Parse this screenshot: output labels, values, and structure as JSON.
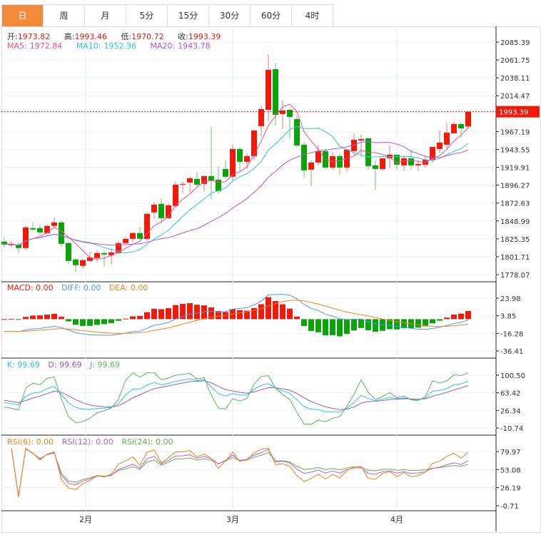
{
  "tabs": [
    {
      "label": "日",
      "active": true
    },
    {
      "label": "周"
    },
    {
      "label": "月"
    },
    {
      "label": "5分"
    },
    {
      "label": "15分"
    },
    {
      "label": "30分"
    },
    {
      "label": "60分"
    },
    {
      "label": "4时"
    }
  ],
  "ohlc_legend": {
    "open_label": "开:",
    "open": "1973.82",
    "high_label": "高:",
    "high": "1993.46",
    "low_label": "低:",
    "low": "1970.72",
    "close_label": "收:",
    "close": "1993.39"
  },
  "ma_legend": {
    "ma5_label": "MA5:",
    "ma5": "1972.84",
    "ma10_label": "MA10:",
    "ma10": "1952.36",
    "ma20_label": "MA20:",
    "ma20": "1943.78"
  },
  "macd_legend": {
    "macd": "MACD: 0.00",
    "diff": "DIFF: 0.00",
    "dea": "DEA: 0.00"
  },
  "kdj_legend": {
    "k": "K: 99.69",
    "d": "D: 99.69",
    "j": "J: 99.69"
  },
  "rsi_legend": {
    "rsi6": "RSI(6): 0.00",
    "rsi12": "RSI(12): 0.00",
    "rsi24": "RSI(24): 0.00"
  },
  "colors": {
    "up": "#f0190a",
    "down": "#0aa30a",
    "ma5": "#f0508c",
    "ma10": "#2ec7e0",
    "ma20": "#b25ad1",
    "diff": "#4a9ee8",
    "dea": "#f5821f",
    "k": "#2ec7e0",
    "d": "#8a5cd1",
    "j": "#5cb85c",
    "rsi6": "#f5821f",
    "rsi12": "#b362d0",
    "rsi24": "#62b34a",
    "accent": "#f28c3c"
  },
  "chart_data": {
    "type": "candlestick",
    "last_price_label": "1993.39",
    "last_price": 1993.39,
    "price_ticks": [
      "2085.39",
      "2061.75",
      "2038.11",
      "2014.47",
      "1967.19",
      "1943.55",
      "1919.91",
      "1896.27",
      "1872.63",
      "1848.99",
      "1825.35",
      "1801.71",
      "1778.07"
    ],
    "price_range": [
      1778.07,
      2085.39
    ],
    "macd_ticks": [
      "23.98",
      "3.85",
      "-16.28",
      "-36.41"
    ],
    "macd_range": [
      -36.41,
      23.98
    ],
    "kdj_ticks": [
      "100.50",
      "63.42",
      "26.34",
      "-10.74"
    ],
    "kdj_range": [
      -10.74,
      100.5
    ],
    "rsi_ticks": [
      "79.97",
      "53.08",
      "26.19",
      "-0.71"
    ],
    "rsi_range": [
      -0.71,
      79.97
    ],
    "x_labels": [
      {
        "label": "2月",
        "index": 12
      },
      {
        "label": "3月",
        "index": 32
      },
      {
        "label": "4月",
        "index": 55
      }
    ],
    "candles": [
      [
        1821.7,
        1827.3,
        1814.1,
        1817.9
      ],
      [
        1817.0,
        1822.6,
        1814.1,
        1818.8
      ],
      [
        1817.9,
        1820.7,
        1806.6,
        1813.2
      ],
      [
        1813.2,
        1843.3,
        1810.4,
        1840.5
      ],
      [
        1839.6,
        1847.1,
        1835.8,
        1837.7
      ],
      [
        1839.6,
        1843.3,
        1830.1,
        1833.9
      ],
      [
        1833.0,
        1844.3,
        1831.1,
        1842.4
      ],
      [
        1842.4,
        1853.7,
        1839.6,
        1847.1
      ],
      [
        1847.1,
        1849.9,
        1815.1,
        1818.8
      ],
      [
        1819.8,
        1821.7,
        1791.5,
        1796.2
      ],
      [
        1798.1,
        1800.0,
        1781.2,
        1790.6
      ],
      [
        1789.6,
        1799.1,
        1785.9,
        1797.2
      ],
      [
        1796.2,
        1808.5,
        1795.3,
        1800.9
      ],
      [
        1800.0,
        1810.4,
        1794.3,
        1806.6
      ],
      [
        1806.6,
        1809.4,
        1788.7,
        1804.7
      ],
      [
        1803.8,
        1813.2,
        1791.5,
        1807.5
      ],
      [
        1806.6,
        1822.6,
        1805.6,
        1819.8
      ],
      [
        1819.8,
        1827.3,
        1817.9,
        1825.4
      ],
      [
        1825.4,
        1834.8,
        1821.7,
        1833.0
      ],
      [
        1833.0,
        1841.4,
        1825.4,
        1825.4
      ],
      [
        1825.4,
        1861.2,
        1822.6,
        1858.4
      ],
      [
        1860.3,
        1873.5,
        1851.8,
        1870.6
      ],
      [
        1871.6,
        1879.1,
        1845.2,
        1852.7
      ],
      [
        1852.7,
        1872.5,
        1850.9,
        1869.7
      ],
      [
        1868.8,
        1900.8,
        1866.9,
        1897.0
      ],
      [
        1897.0,
        1901.7,
        1885.7,
        1898.0
      ],
      [
        1899.8,
        1907.4,
        1886.7,
        1905.5
      ],
      [
        1904.6,
        1913.0,
        1894.2,
        1897.0
      ],
      [
        1898.0,
        1909.3,
        1888.5,
        1908.3
      ],
      [
        1908.3,
        1973.3,
        1878.2,
        1902.7
      ],
      [
        1903.6,
        1920.6,
        1884.8,
        1888.5
      ],
      [
        1917.7,
        1930.0,
        1904.6,
        1907.4
      ],
      [
        1907.4,
        1949.8,
        1900.8,
        1944.1
      ],
      [
        1944.1,
        1946.9,
        1914.9,
        1927.2
      ],
      [
        1927.2,
        1938.5,
        1917.7,
        1934.7
      ],
      [
        1934.7,
        1969.6,
        1929.0,
        1968.6
      ],
      [
        1974.3,
        2001.6,
        1960.1,
        1996.9
      ],
      [
        1995.9,
        2069.4,
        1980.9,
        2048.7
      ],
      [
        2049.6,
        2058.1,
        1975.2,
        1989.3
      ],
      [
        1990.3,
        2008.2,
        1970.5,
        1995.0
      ],
      [
        1995.9,
        1997.8,
        1958.3,
        1986.5
      ],
      [
        1983.7,
        1988.4,
        1946.9,
        1948.8
      ],
      [
        1949.8,
        1953.5,
        1906.4,
        1915.9
      ],
      [
        1916.8,
        1929.0,
        1895.1,
        1926.2
      ],
      [
        1926.2,
        1948.8,
        1922.5,
        1941.3
      ],
      [
        1941.3,
        1944.1,
        1917.7,
        1919.6
      ],
      [
        1919.6,
        1940.4,
        1916.8,
        1934.7
      ],
      [
        1934.7,
        1937.5,
        1910.2,
        1919.6
      ],
      [
        1919.6,
        1944.1,
        1914.0,
        1943.2
      ],
      [
        1941.3,
        1964.8,
        1936.6,
        1956.4
      ],
      [
        1955.4,
        1963.0,
        1933.8,
        1957.3
      ],
      [
        1958.3,
        1958.3,
        1916.8,
        1921.5
      ],
      [
        1922.5,
        1929.0,
        1889.5,
        1917.7
      ],
      [
        1917.7,
        1931.9,
        1914.9,
        1931.9
      ],
      [
        1931.9,
        1948.8,
        1918.7,
        1936.6
      ],
      [
        1936.6,
        1936.6,
        1916.8,
        1923.4
      ],
      [
        1922.5,
        1935.6,
        1914.9,
        1931.9
      ],
      [
        1931.9,
        1943.2,
        1916.8,
        1922.5
      ],
      [
        1922.5,
        1929.0,
        1914.9,
        1924.3
      ],
      [
        1923.4,
        1935.6,
        1919.6,
        1930.0
      ],
      [
        1930.0,
        1946.9,
        1926.2,
        1946.9
      ],
      [
        1944.1,
        1968.6,
        1938.5,
        1952.6
      ],
      [
        1949.8,
        1978.0,
        1943.2,
        1965.8
      ],
      [
        1964.8,
        1979.8,
        1964.8,
        1977.1
      ],
      [
        1977.1,
        1979.0,
        1959.2,
        1971.4
      ],
      [
        1973.82,
        1993.46,
        1970.72,
        1993.39
      ]
    ]
  }
}
